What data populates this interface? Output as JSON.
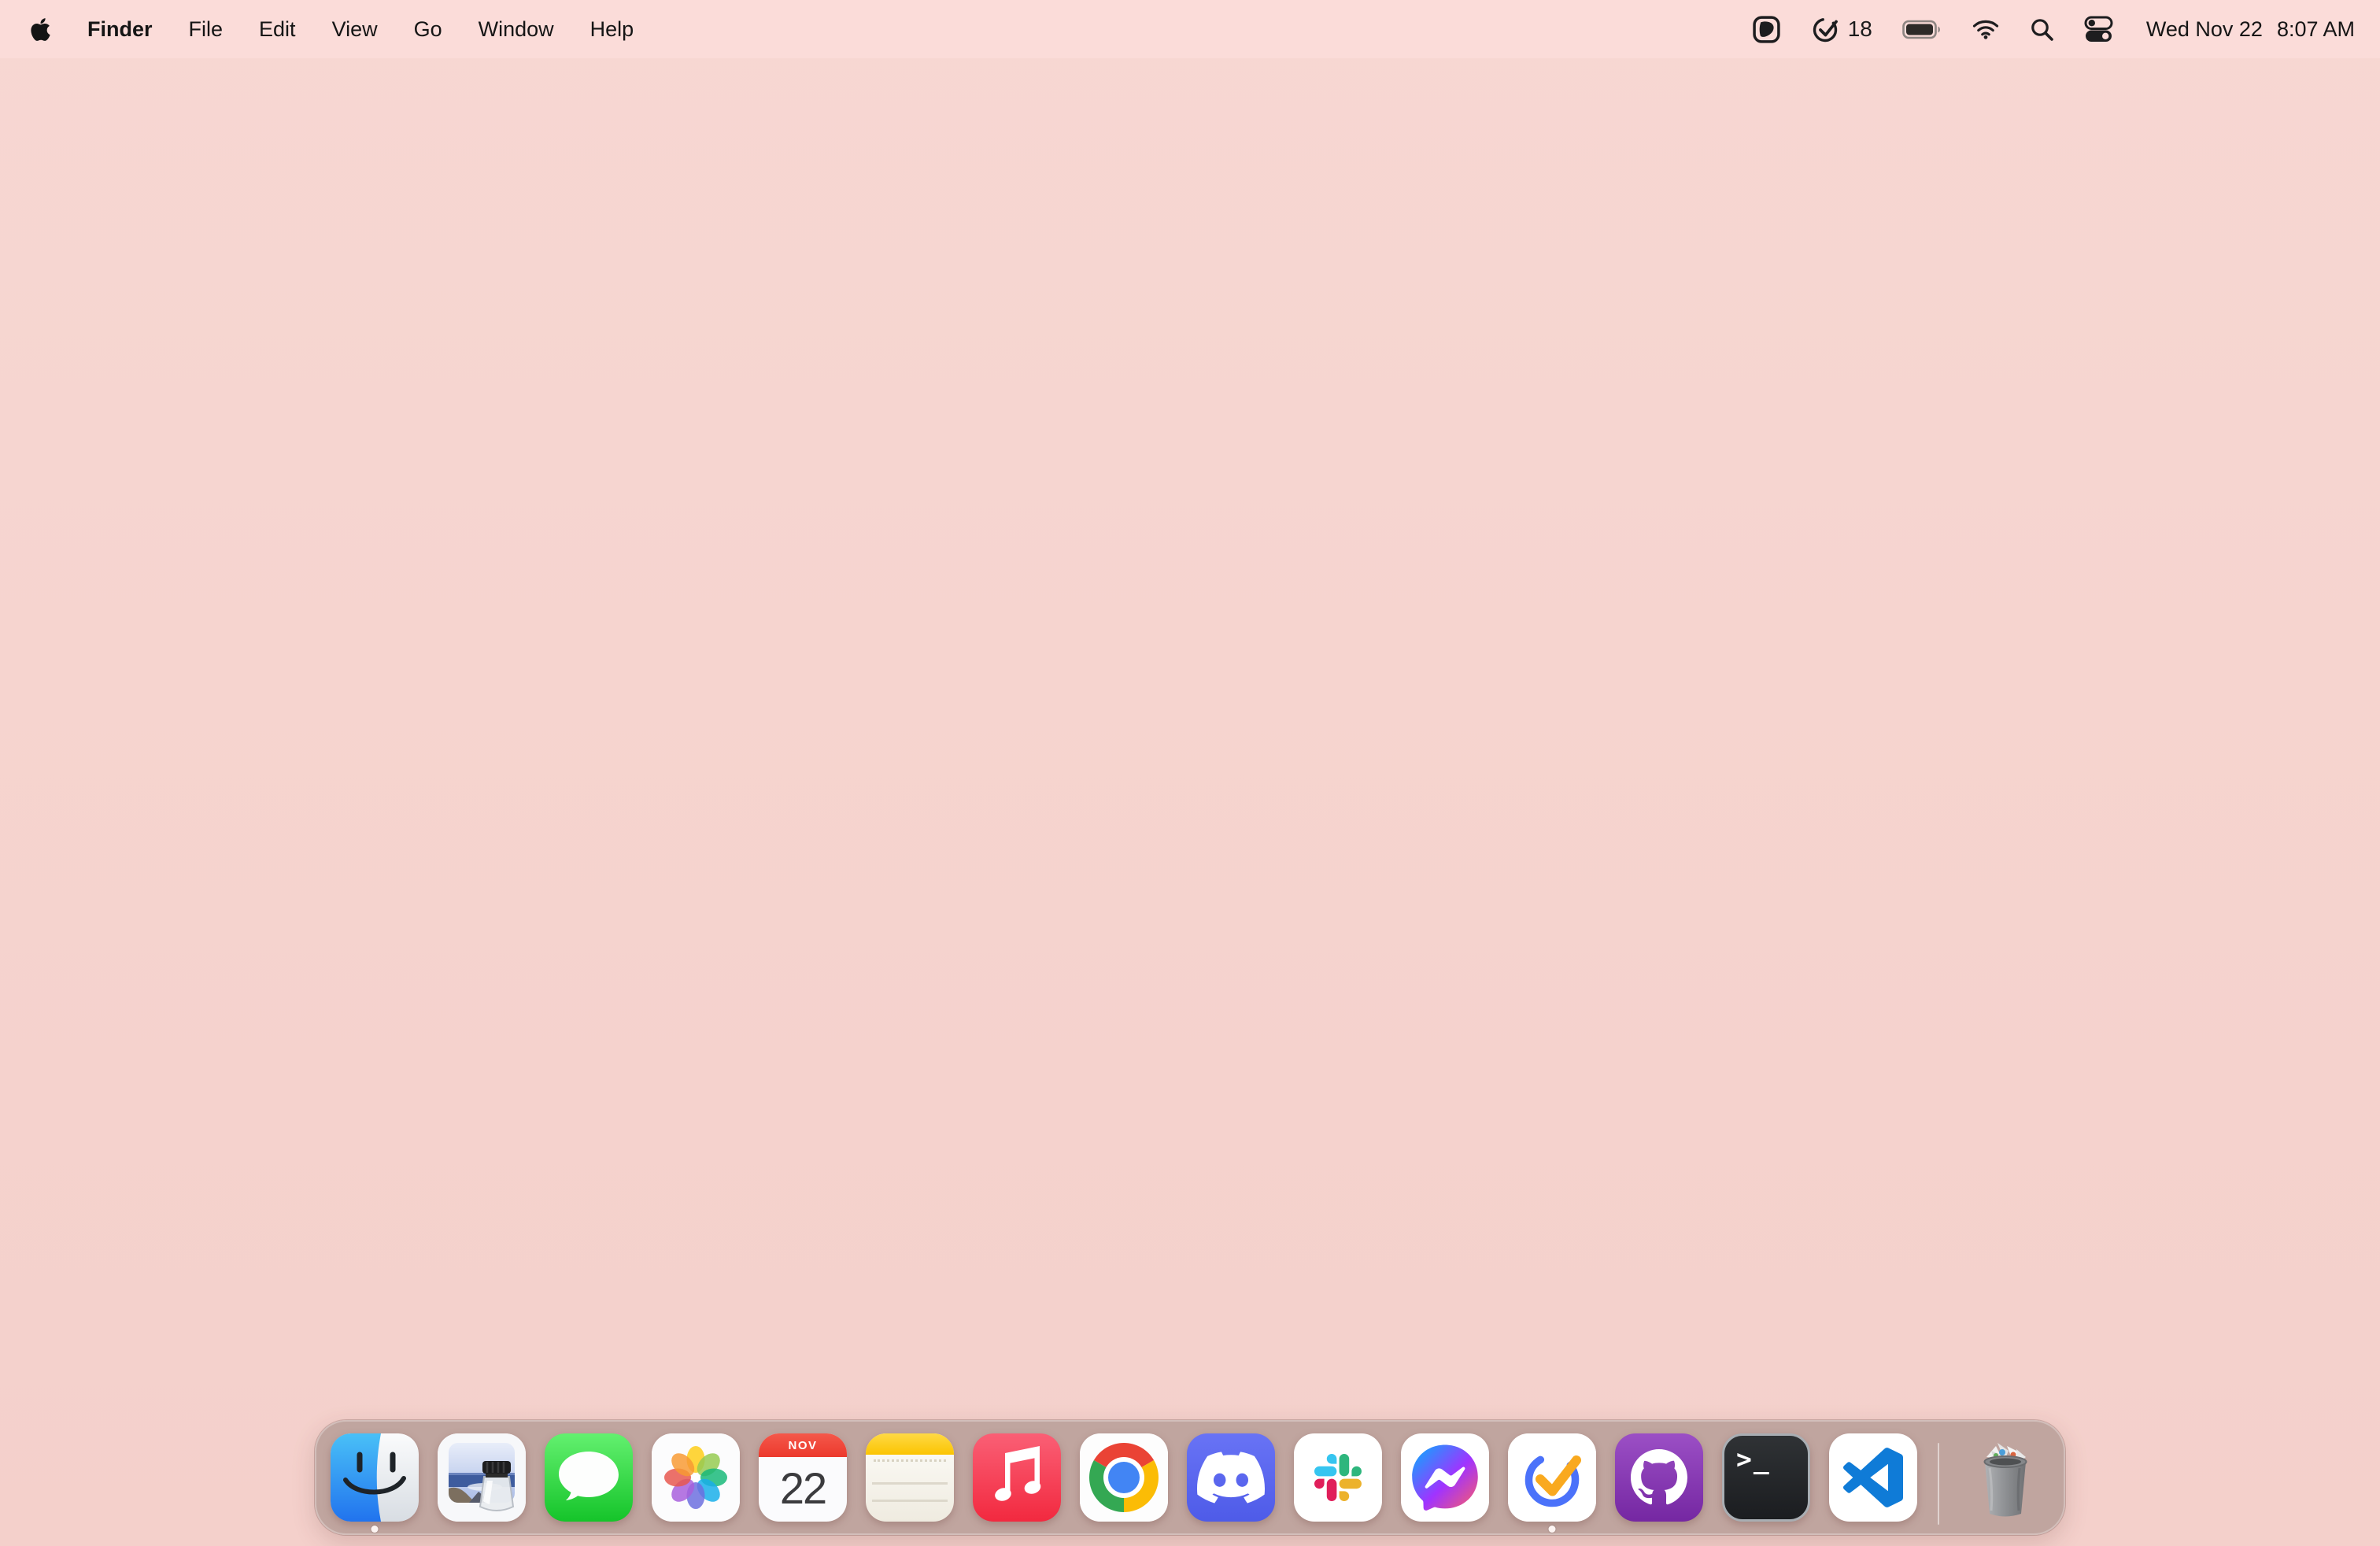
{
  "colors": {
    "wallpaper": "#F5D3CE",
    "menubar_bg": "#FBDCD9",
    "dock_bg": "#B89E99",
    "calendar_red": "#EE4437",
    "ticktick_blue": "#4772FA",
    "ticktick_check_orange": "#F9A91F"
  },
  "menu_bar": {
    "apple_icon": "apple-logo-icon",
    "app_menu_items": [
      {
        "label": "Finder",
        "bold": true
      },
      {
        "label": "File"
      },
      {
        "label": "Edit"
      },
      {
        "label": "View"
      },
      {
        "label": "Go"
      },
      {
        "label": "Window"
      },
      {
        "label": "Help"
      }
    ],
    "status": {
      "icons": [
        "paste-pick-icon",
        "ticktick-check-icon",
        "battery-icon",
        "wifi-icon",
        "spotlight-search-icon",
        "control-center-icon"
      ],
      "task_count": "18",
      "date": "Wed Nov 22",
      "time": "8:07 AM"
    }
  },
  "dock": {
    "items": [
      {
        "name": "finder",
        "running": true
      },
      {
        "name": "preview",
        "running": false
      },
      {
        "name": "messages",
        "running": false
      },
      {
        "name": "photos",
        "running": false
      },
      {
        "name": "calendar",
        "running": false,
        "badge_month": "NOV",
        "badge_day": "22"
      },
      {
        "name": "notes",
        "running": false
      },
      {
        "name": "music",
        "running": false
      },
      {
        "name": "chrome",
        "running": false
      },
      {
        "name": "discord",
        "running": false
      },
      {
        "name": "slack",
        "running": false
      },
      {
        "name": "messenger",
        "running": false
      },
      {
        "name": "ticktick",
        "running": true
      },
      {
        "name": "github-desktop",
        "running": false
      },
      {
        "name": "terminal",
        "running": false,
        "glyph": ">_"
      },
      {
        "name": "vscode",
        "running": false
      }
    ],
    "trash": {
      "name": "trash",
      "state": "full"
    }
  }
}
